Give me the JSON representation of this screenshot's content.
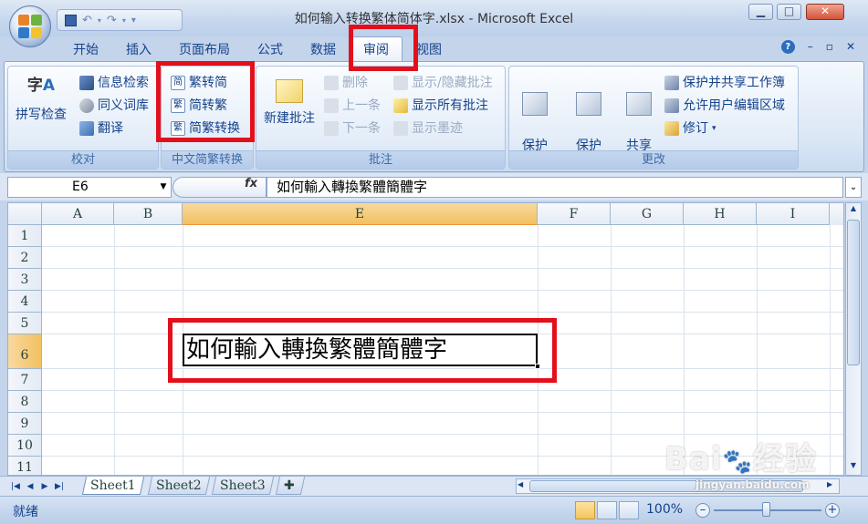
{
  "window": {
    "title": "如何输入转换繁体简体字.xlsx - Microsoft Excel"
  },
  "ribbon": {
    "tabs": [
      "开始",
      "插入",
      "页面布局",
      "公式",
      "数据",
      "审阅",
      "视图"
    ],
    "active_tab": "审阅",
    "groups": {
      "proofing": {
        "label": "校对",
        "spelling": "拼写检查",
        "research": "信息检索",
        "thesaurus": "同义词库",
        "translate": "翻译"
      },
      "chinese": {
        "label": "中文简繁转换",
        "to_simplified": "繁转简",
        "to_traditional": "简转繁",
        "conversion": "简繁转换"
      },
      "comments": {
        "label": "批注",
        "new_comment": "新建批注",
        "delete": "删除",
        "previous": "上一条",
        "next": "下一条",
        "show_hide": "显示/隐藏批注",
        "show_all": "显示所有批注",
        "show_ink": "显示墨迹"
      },
      "changes": {
        "label": "更改",
        "protect_sheet": "保护\n工作表",
        "protect_workbook": "保护\n工作簿",
        "share_workbook": "共享\n工作簿",
        "protect_share": "保护并共享工作簿",
        "allow_edit": "允许用户编辑区域",
        "track": "修订"
      }
    }
  },
  "formula_bar": {
    "name_box": "E6",
    "fx": "fx",
    "value": "如何輸入轉換繁體簡體字"
  },
  "grid": {
    "columns": [
      "A",
      "B",
      "E",
      "F",
      "G",
      "H",
      "I"
    ],
    "selected_column": "E",
    "rows": [
      "1",
      "2",
      "3",
      "4",
      "5",
      "6",
      "7",
      "8",
      "9",
      "10",
      "11"
    ],
    "selected_row": "6",
    "active_cell": {
      "ref": "E6",
      "value": "如何輸入轉換繁體簡體字"
    }
  },
  "sheets": [
    "Sheet1",
    "Sheet2",
    "Sheet3"
  ],
  "active_sheet": "Sheet1",
  "status": {
    "text": "就绪",
    "zoom": "100%"
  },
  "watermark": {
    "logo": "Baidu 经验",
    "url": "jingyan.baidu.com"
  },
  "colors": {
    "highlight": "#e3101b",
    "selected_header": "#f1c15f",
    "ribbon_text": "#15428b"
  }
}
